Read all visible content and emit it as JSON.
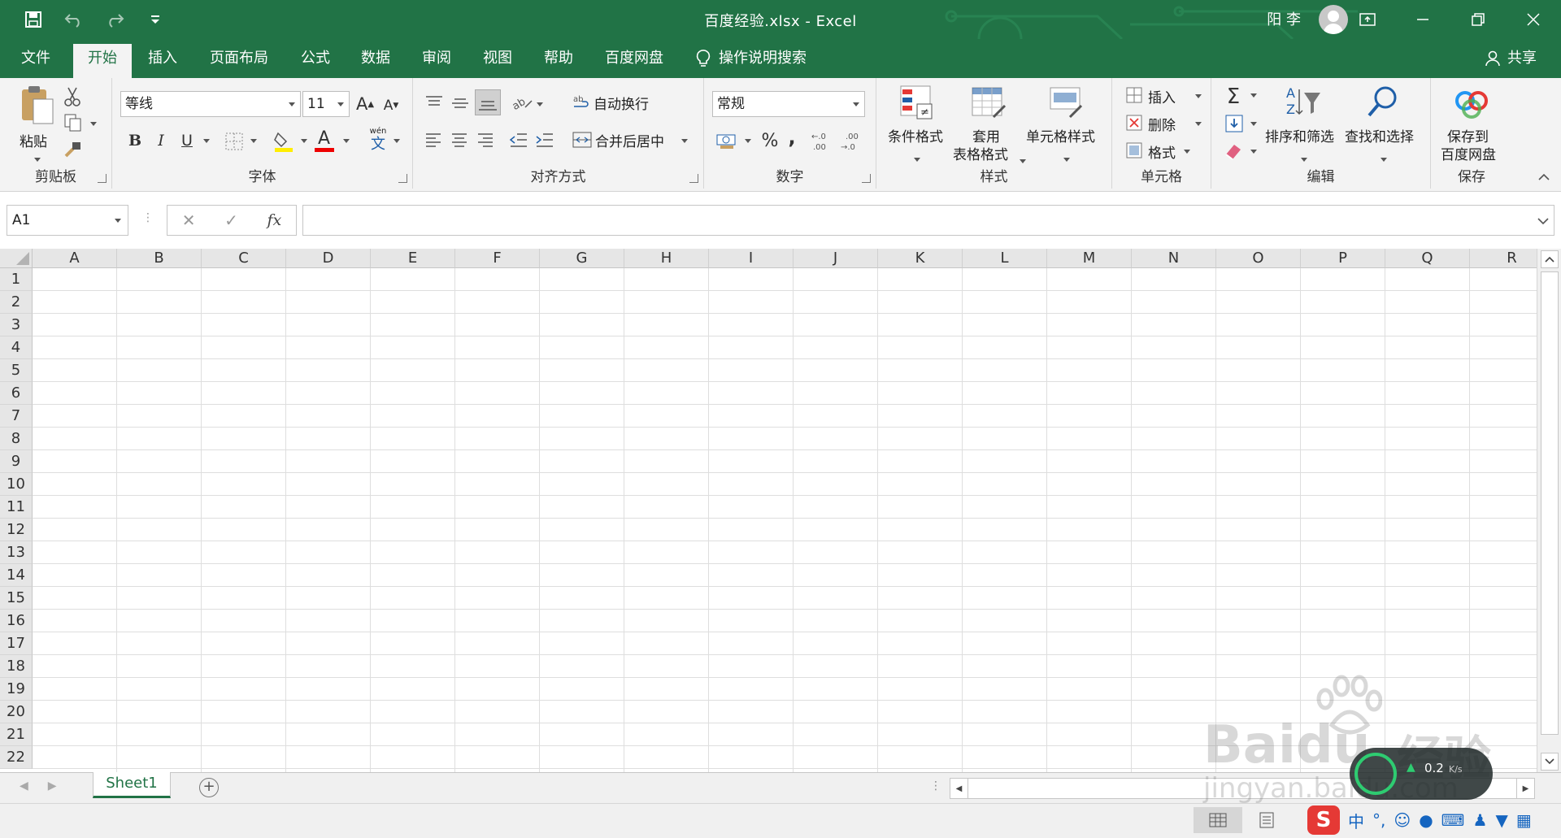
{
  "window": {
    "title": "百度经验.xlsx  -  Excel",
    "user": "阳 李"
  },
  "tabs": [
    "文件",
    "开始",
    "插入",
    "页面布局",
    "公式",
    "数据",
    "审阅",
    "视图",
    "帮助",
    "百度网盘"
  ],
  "active_tab": "开始",
  "tell_me": "操作说明搜索",
  "share": "共享",
  "ribbon": {
    "clipboard": {
      "label": "剪贴板",
      "paste": "粘贴"
    },
    "font": {
      "label": "字体",
      "font_name": "等线",
      "font_size": "11",
      "bold": "B",
      "italic": "I",
      "underline": "U",
      "wen": "wén",
      "wen2": "文"
    },
    "alignment": {
      "label": "对齐方式",
      "wrap": "自动换行",
      "merge": "合并后居中"
    },
    "number": {
      "label": "数字",
      "format": "常规",
      "percent": "%",
      "comma": ","
    },
    "styles": {
      "label": "样式",
      "conditional": "条件格式",
      "table1": "套用",
      "table2": "表格格式",
      "cell_styles": "单元格样式"
    },
    "cells": {
      "label": "单元格",
      "insert": "插入",
      "delete": "删除",
      "format": "格式"
    },
    "editing": {
      "label": "编辑",
      "sort": "排序和筛选",
      "find": "查找和选择"
    },
    "save": {
      "label": "保存",
      "save1": "保存到",
      "save2": "百度网盘"
    }
  },
  "formula_bar": {
    "name_box": "A1",
    "fx": "fx",
    "value": ""
  },
  "columns": [
    "A",
    "B",
    "C",
    "D",
    "E",
    "F",
    "G",
    "H",
    "I",
    "J",
    "K",
    "L",
    "M",
    "N",
    "O",
    "P",
    "Q",
    "R"
  ],
  "rows": [
    "1",
    "2",
    "3",
    "4",
    "5",
    "6",
    "7",
    "8",
    "9",
    "10",
    "11",
    "12",
    "13",
    "14",
    "15",
    "16",
    "17",
    "18",
    "19",
    "20",
    "21",
    "22"
  ],
  "sheet": {
    "tab": "Sheet1"
  },
  "network": {
    "speed": "0.2",
    "unit": "K/s"
  },
  "watermark": {
    "brand": "Baidu",
    "site": "jingyan.baidu.com",
    "title": "经验"
  },
  "colors": {
    "accent": "#217346",
    "ribbon_bg": "#f3f3f3",
    "grid": "#dedede"
  }
}
